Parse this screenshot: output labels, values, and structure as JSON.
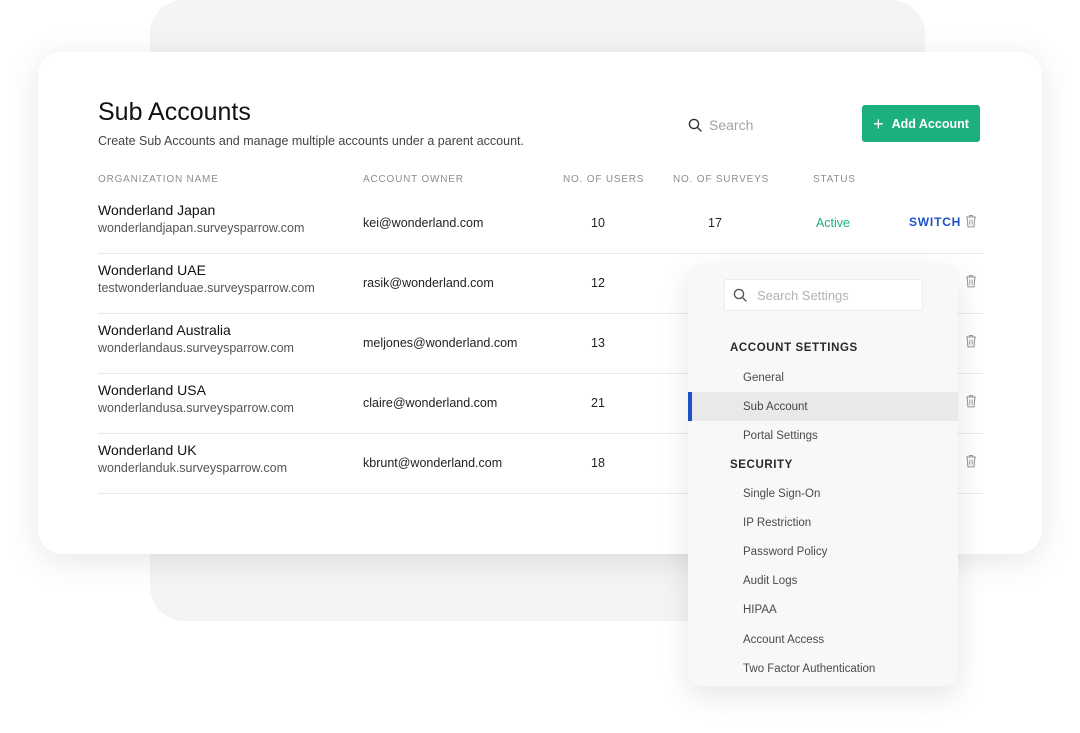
{
  "header": {
    "title": "Sub Accounts",
    "subtitle": "Create Sub Accounts and manage multiple accounts under a parent account.",
    "search_placeholder": "Search",
    "add_button_label": "Add Account"
  },
  "table": {
    "columns": {
      "org": "ORGANIZATION NAME",
      "owner": "ACCOUNT OWNER",
      "users": "NO. OF USERS",
      "surveys": "NO. OF SURVEYS",
      "status": "STATUS"
    },
    "switch_label": "SWITCH",
    "rows": [
      {
        "name": "Wonderland Japan",
        "domain": "wonderlandjapan.surveysparrow.com",
        "owner": "kei@wonderland.com",
        "users": "10",
        "surveys": "17",
        "status": "Active"
      },
      {
        "name": "Wonderland UAE",
        "domain": "testwonderlanduae.surveysparrow.com",
        "owner": "rasik@wonderland.com",
        "users": "12"
      },
      {
        "name": "Wonderland Australia",
        "domain": "wonderlandaus.surveysparrow.com",
        "owner": "meljones@wonderland.com",
        "users": "13"
      },
      {
        "name": "Wonderland USA",
        "domain": "wonderlandusa.surveysparrow.com",
        "owner": "claire@wonderland.com",
        "users": "21"
      },
      {
        "name": "Wonderland UK",
        "domain": "wonderlanduk.surveysparrow.com",
        "owner": "kbrunt@wonderland.com",
        "users": "18"
      }
    ]
  },
  "settings_panel": {
    "search_placeholder": "Search Settings",
    "account_settings": {
      "heading": "ACCOUNT SETTINGS",
      "items": [
        "General",
        "Sub Account",
        "Portal Settings"
      ],
      "active_item": "Sub Account"
    },
    "security": {
      "heading": "SECURITY",
      "items": [
        "Single Sign-On",
        "IP Restriction",
        "Password Policy",
        "Audit Logs",
        "HIPAA",
        "Account Access",
        "Two Factor Authentication"
      ]
    }
  },
  "colors": {
    "accent_green": "#1bb07c",
    "link_blue": "#1d51c8",
    "status_active": "#1bb07c"
  }
}
